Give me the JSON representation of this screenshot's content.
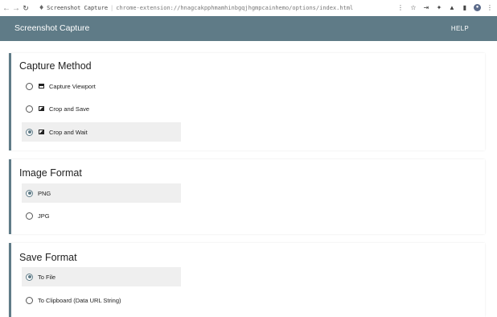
{
  "browser": {
    "site_name": "Screenshot Capture",
    "url": "chrome-extension://hnagcakpphmamhinbgqjhgmpcainhemo/options/index.html"
  },
  "header": {
    "title": "Screenshot Capture",
    "help_label": "HELP"
  },
  "sections": {
    "capture_method": {
      "title": "Capture Method",
      "options": [
        {
          "label": "Capture Viewport",
          "icon": "viewport-icon",
          "selected": false
        },
        {
          "label": "Crop and Save",
          "icon": "crop-icon",
          "selected": false
        },
        {
          "label": "Crop and Wait",
          "icon": "crop-icon",
          "selected": true
        }
      ]
    },
    "image_format": {
      "title": "Image Format",
      "options": [
        {
          "label": "PNG",
          "selected": true
        },
        {
          "label": "JPG",
          "selected": false
        }
      ]
    },
    "save_format": {
      "title": "Save Format",
      "options": [
        {
          "label": "To File",
          "selected": true
        },
        {
          "label": "To Clipboard (Data URL String)",
          "selected": false
        }
      ]
    }
  },
  "colors": {
    "header_bg": "#5f7b87",
    "accent": "#5f7b87",
    "selected_row_bg": "#efefef"
  }
}
